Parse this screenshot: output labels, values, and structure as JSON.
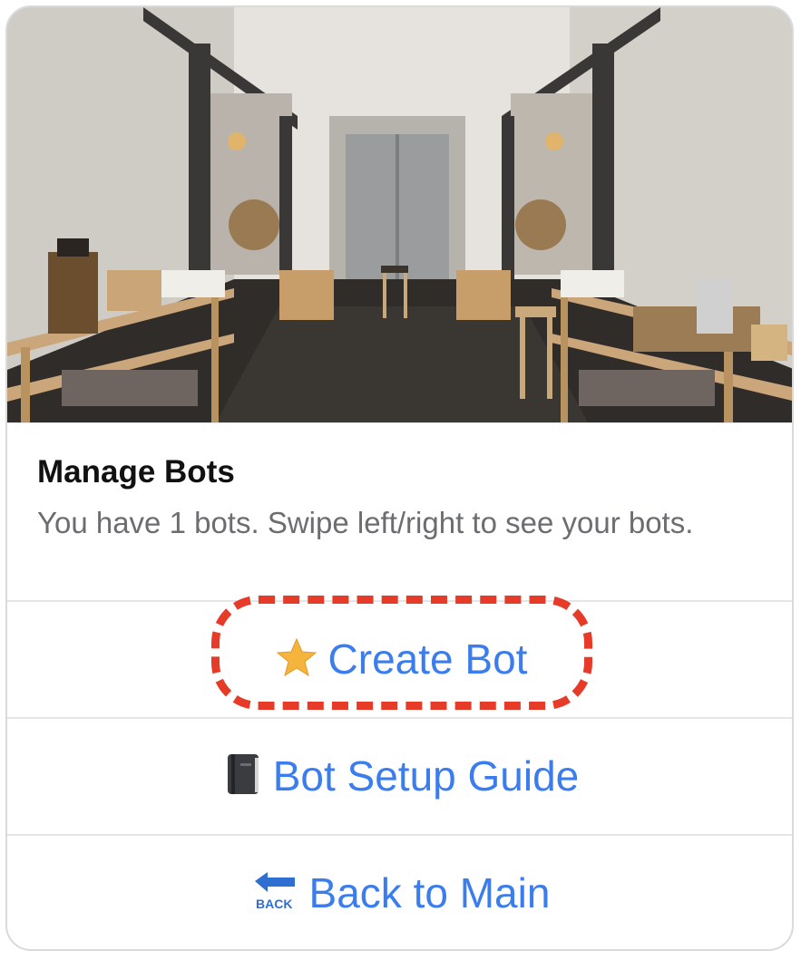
{
  "card": {
    "title": "Manage Bots",
    "subtitle": "You have 1 bots. Swipe left/right to see your bots."
  },
  "hero_image": {
    "description_icon": "cafe-interior-photo"
  },
  "actions": [
    {
      "icon": "star-icon",
      "label": "Create Bot"
    },
    {
      "icon": "notebook-icon",
      "label": "Bot Setup Guide"
    },
    {
      "icon": "back-arrow-icon",
      "label": "Back to Main",
      "icon_text": "BACK"
    }
  ],
  "colors": {
    "link": "#3b7ded",
    "highlight": "#e53b28",
    "divider": "#e4e5e7",
    "subtitle": "#6b6d70"
  }
}
